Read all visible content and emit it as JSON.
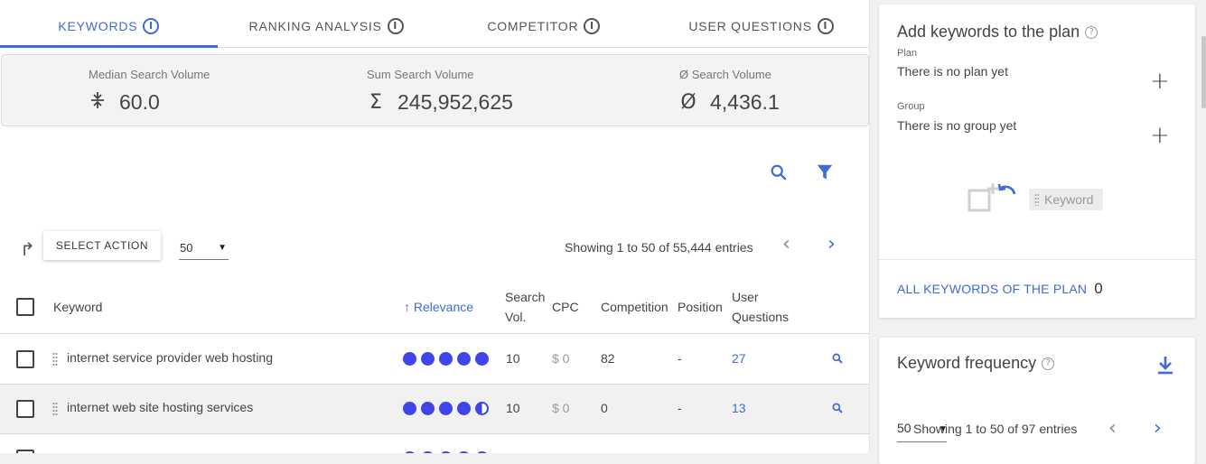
{
  "tabs": [
    {
      "label": "KEYWORDS",
      "active": true
    },
    {
      "label": "RANKING ANALYSIS",
      "active": false
    },
    {
      "label": "COMPETITOR",
      "active": false
    },
    {
      "label": "USER QUESTIONS",
      "active": false
    }
  ],
  "stats": [
    {
      "label": "Median Search Volume",
      "symbol": "∓",
      "value": "60.0"
    },
    {
      "label": "Sum Search Volume",
      "symbol": "Σ",
      "value": "245,952,625"
    },
    {
      "label": "Ø Search Volume",
      "symbol": "Ø",
      "value": "4,436.1"
    }
  ],
  "toolbar": {
    "select_action": "SELECT ACTION",
    "per_page": "50",
    "showing": "Showing 1 to 50 of 55,444 entries"
  },
  "table": {
    "headers": {
      "keyword": "Keyword",
      "relevance": "↑ Relevance",
      "search_vol_1": "Search",
      "search_vol_2": "Vol.",
      "cpc": "CPC",
      "competition": "Competition",
      "position": "Position",
      "user_q_1": "User",
      "user_q_2": "Questions"
    },
    "rows": [
      {
        "keyword": "internet service provider web hosting",
        "relevance": 5,
        "search_vol": "10",
        "cpc": "$ 0",
        "competition": "82",
        "position": "-",
        "user_questions": "27"
      },
      {
        "keyword": "internet web site hosting services",
        "relevance": 4.5,
        "search_vol": "10",
        "cpc": "$ 0",
        "competition": "0",
        "position": "-",
        "user_questions": "13"
      }
    ]
  },
  "plan_card": {
    "title": "Add keywords to the plan",
    "plan_label": "Plan",
    "plan_value": "There is no plan yet",
    "group_label": "Group",
    "group_value": "There is no group yet",
    "keyword_chip": "Keyword",
    "all_keywords_label": "ALL KEYWORDS OF THE PLAN",
    "all_keywords_count": "0"
  },
  "frequency_card": {
    "title": "Keyword frequency",
    "per_page": "50",
    "showing": "Showing 1 to 50 of 97 entries"
  },
  "colors": {
    "accent": "#3f6ad8",
    "relevance_dot": "#3f45e6"
  }
}
